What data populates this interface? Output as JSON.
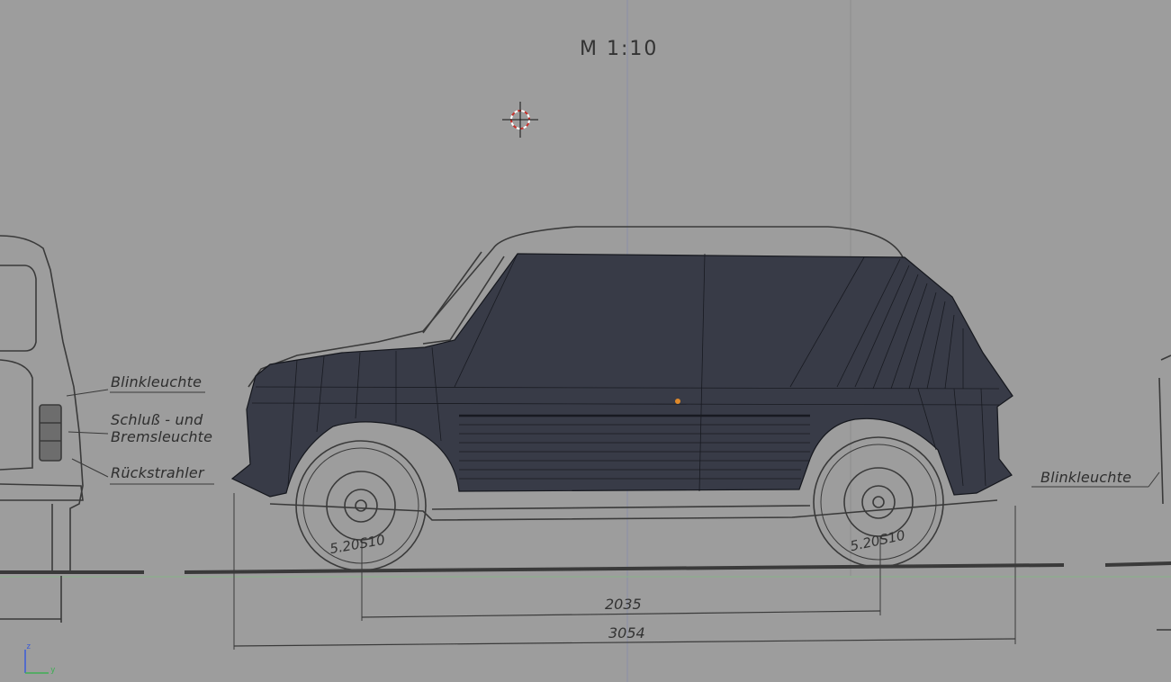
{
  "viewport": {
    "scale_label": "M 1:10",
    "labels": {
      "blinkleuchte_left": "Blinkleuchte",
      "schluss_line1": "Schluß - und",
      "schluss_line2": "Bremsleuchte",
      "rueckstrahler": "Rückstrahler",
      "blinkleuchte_right": "Blinkleuchte"
    },
    "tire_front": "5.20S10",
    "tire_rear": "5.20S10",
    "dim_wheelbase": "2035",
    "dim_length": "3054",
    "axis_z": "z",
    "axis_y": "y"
  },
  "colors": {
    "background": "#9d9d9d",
    "mesh": "#383b47",
    "mesh_lines": "#15171d",
    "line_art": "#3a3a3a",
    "axis_z": "#3a5bd8",
    "axis_y": "#3fae55",
    "origin": "#e08a2a",
    "cursor": "#c8312b"
  }
}
